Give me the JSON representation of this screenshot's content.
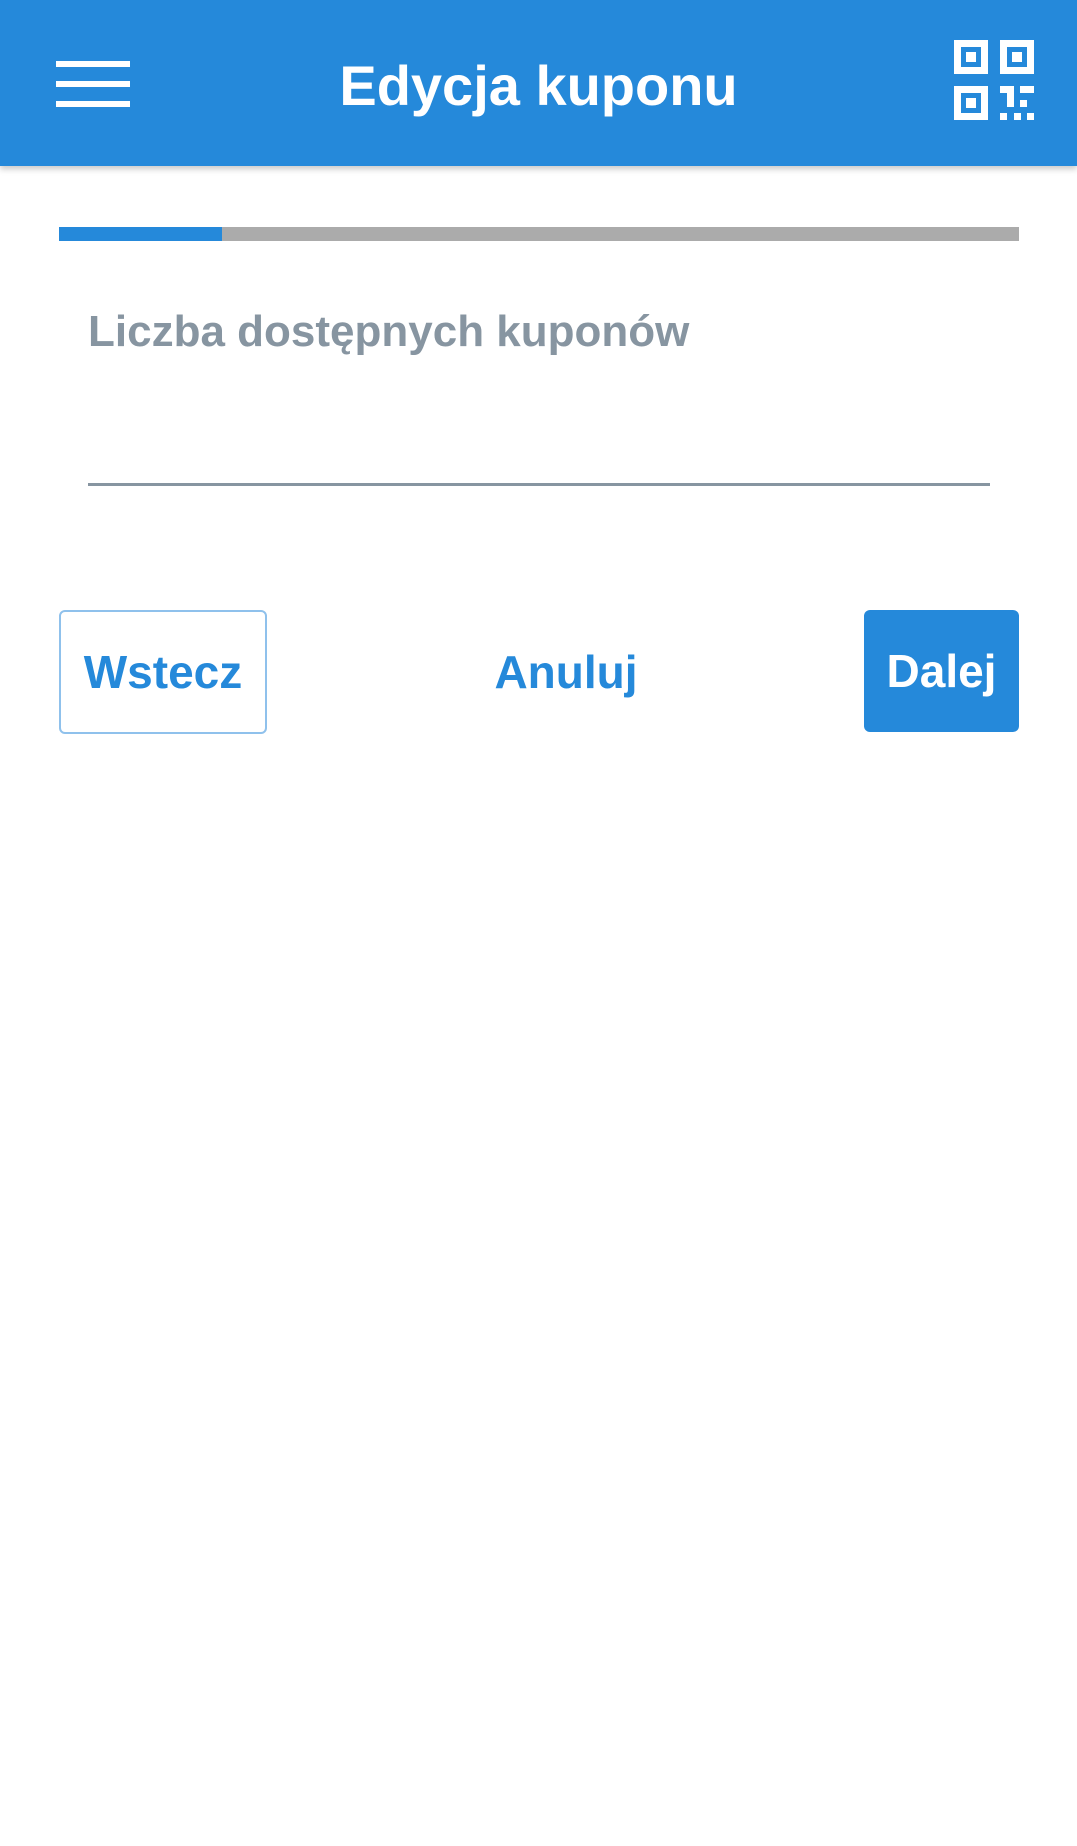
{
  "app_bar": {
    "title": "Edycja kuponu",
    "menu_icon": "hamburger-menu-icon",
    "qr_icon": "qr-code-icon",
    "background_color": "#2589DA"
  },
  "wizard": {
    "progress_fraction": 0.17,
    "progress_color": "#2589DA",
    "track_color": "#ABABAB"
  },
  "form": {
    "available_coupons": {
      "label": "Liczba dostępnych kuponów",
      "value": ""
    }
  },
  "actions": {
    "back_label": "Wstecz",
    "cancel_label": "Anuluj",
    "next_label": "Dalej"
  }
}
